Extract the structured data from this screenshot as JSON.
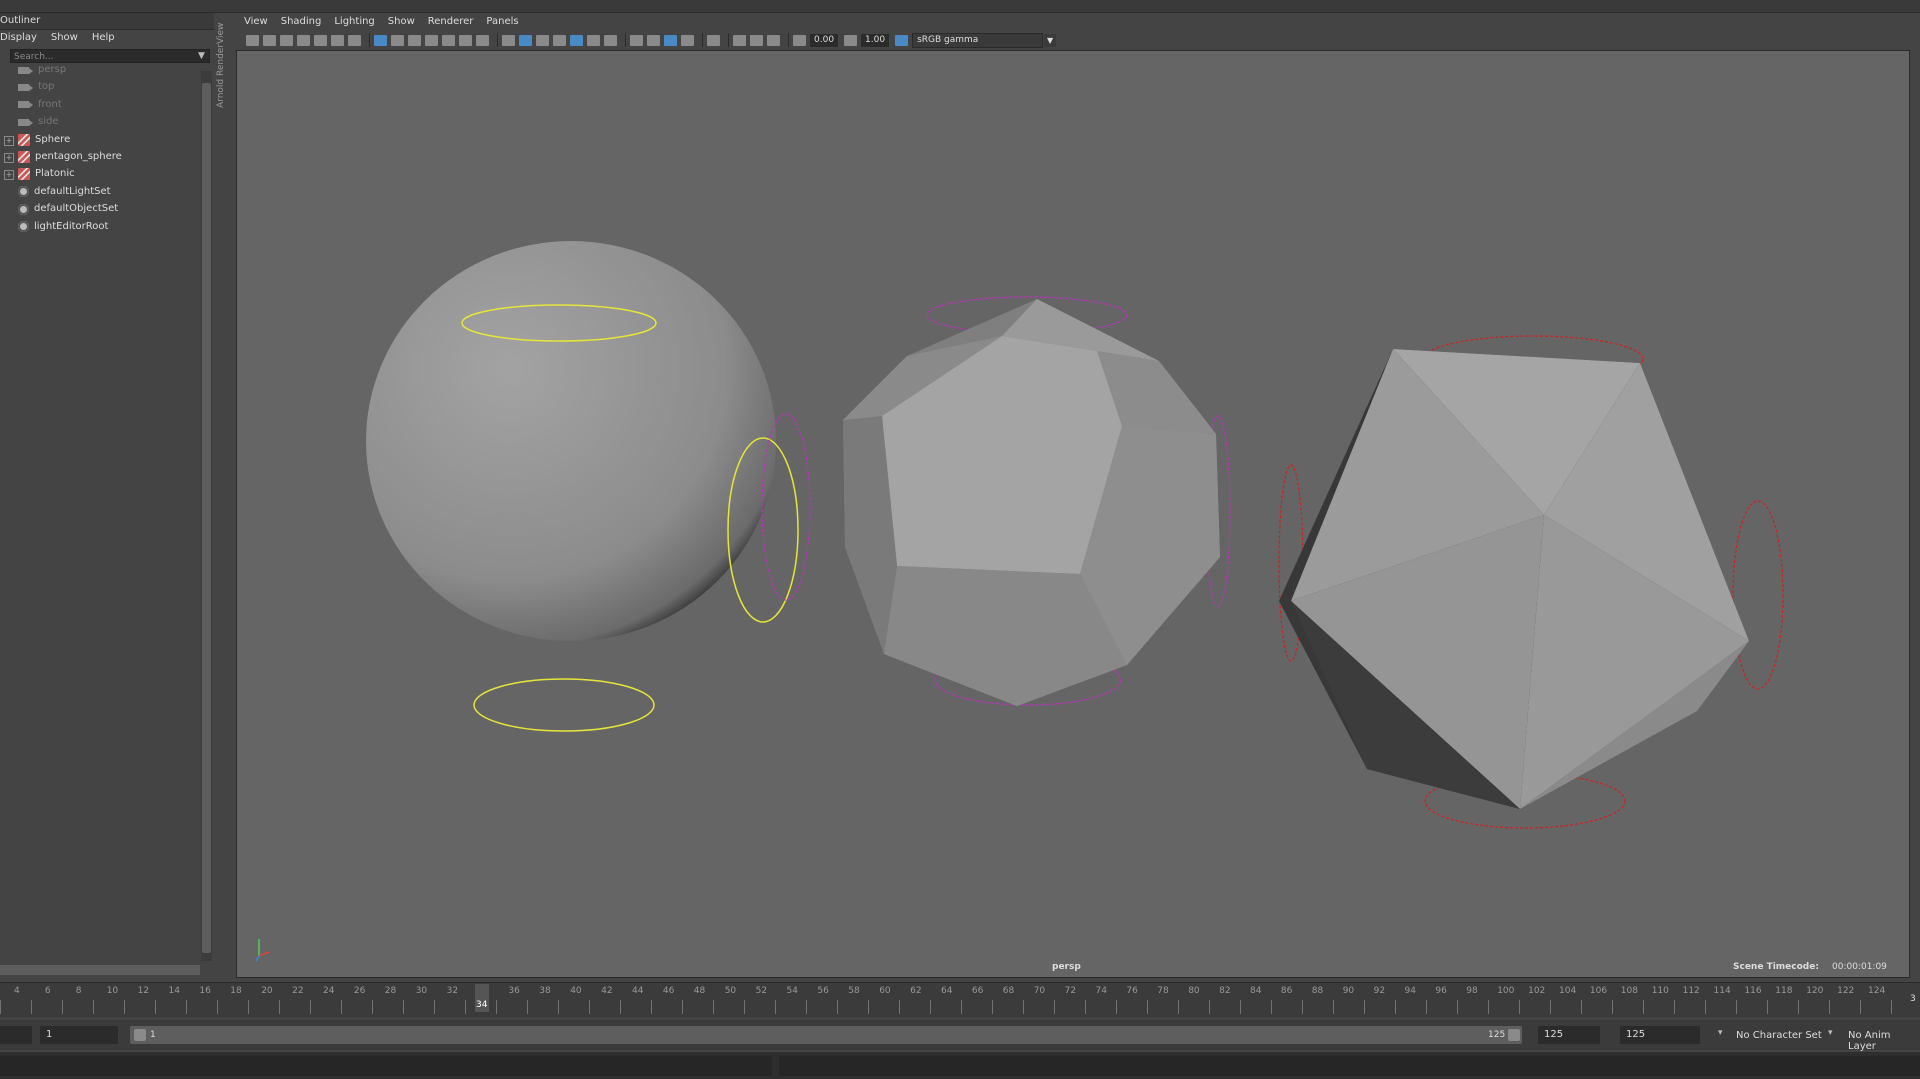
{
  "outliner": {
    "title": "Outliner",
    "menu": [
      "Display",
      "Show",
      "Help"
    ],
    "search_placeholder": "Search...",
    "items": [
      {
        "label": "persp",
        "icon": "camera-icon",
        "dim": true
      },
      {
        "label": "top",
        "icon": "camera-icon",
        "dim": true
      },
      {
        "label": "front",
        "icon": "camera-icon",
        "dim": true
      },
      {
        "label": "side",
        "icon": "camera-icon",
        "dim": true
      },
      {
        "label": "Sphere",
        "icon": "mesh-icon",
        "expandable": true
      },
      {
        "label": "pentagon_sphere",
        "icon": "mesh-icon",
        "expandable": true
      },
      {
        "label": "Platonic",
        "icon": "mesh-icon",
        "expandable": true
      },
      {
        "label": "defaultLightSet",
        "icon": "set-icon"
      },
      {
        "label": "defaultObjectSet",
        "icon": "set-icon"
      },
      {
        "label": "lightEditorRoot",
        "icon": "set-icon"
      }
    ]
  },
  "side_tab": "Arnold RenderView",
  "panel_menu": [
    "View",
    "Shading",
    "Lighting",
    "Show",
    "Renderer",
    "Panels"
  ],
  "toolbar": {
    "exposure": "0.00",
    "gamma": "1.00",
    "colorspace": "sRGB gamma"
  },
  "viewport": {
    "camera": "persp",
    "timecode_label": "Scene Timecode:",
    "timecode_value": "00:00:01:09",
    "colors": {
      "sphere_handle": "#e6e63a",
      "dodeca_handle": "#c030c0",
      "icosa_handle": "#d02020"
    }
  },
  "timeline": {
    "ticks": [
      "4",
      "6",
      "8",
      "10",
      "12",
      "14",
      "16",
      "18",
      "20",
      "22",
      "24",
      "26",
      "28",
      "30",
      "32",
      "34",
      "36",
      "38",
      "40",
      "42",
      "44",
      "46",
      "48",
      "50",
      "52",
      "54",
      "56",
      "58",
      "60",
      "62",
      "64",
      "66",
      "68",
      "70",
      "72",
      "74",
      "76",
      "78",
      "80",
      "82",
      "84",
      "86",
      "88",
      "90",
      "92",
      "94",
      "96",
      "98",
      "100",
      "102",
      "104",
      "106",
      "108",
      "110",
      "112",
      "114",
      "116",
      "118",
      "120",
      "122",
      "124"
    ],
    "current_frame": "34",
    "end_frame_edge": "3"
  },
  "range": {
    "start": "1",
    "range_start": "1",
    "range_end": "125",
    "end1": "125",
    "end2": "125",
    "character_set": "No Character Set",
    "anim_layer": "No Anim Layer"
  }
}
